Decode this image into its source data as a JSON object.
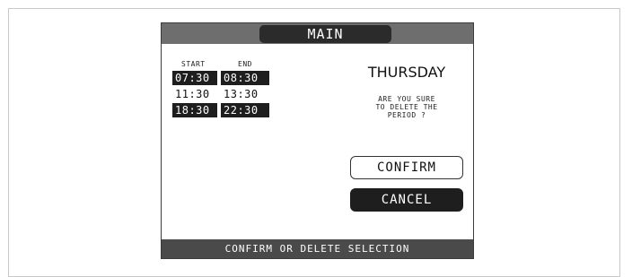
{
  "header": {
    "title": "MAIN"
  },
  "periods": {
    "start_label": "START",
    "end_label": "END",
    "rows": [
      {
        "start": "07:30",
        "end": "08:30",
        "selected": true
      },
      {
        "start": "11:30",
        "end": "13:30",
        "selected": false
      },
      {
        "start": "18:30",
        "end": "22:30",
        "selected": true
      }
    ]
  },
  "dialog": {
    "day": "THURSDAY",
    "question_lines": [
      "ARE YOU SURE",
      "TO DELETE THE",
      "PERIOD ?"
    ]
  },
  "buttons": {
    "confirm_label": "CONFIRM",
    "cancel_label": "CANCEL"
  },
  "status_bar": {
    "text": "CONFIRM OR DELETE SELECTION"
  },
  "colors": {
    "selected_bg": "#1e1e1e",
    "topbar_bg": "#6e6e6e",
    "status_bg": "#4a4a4a"
  }
}
